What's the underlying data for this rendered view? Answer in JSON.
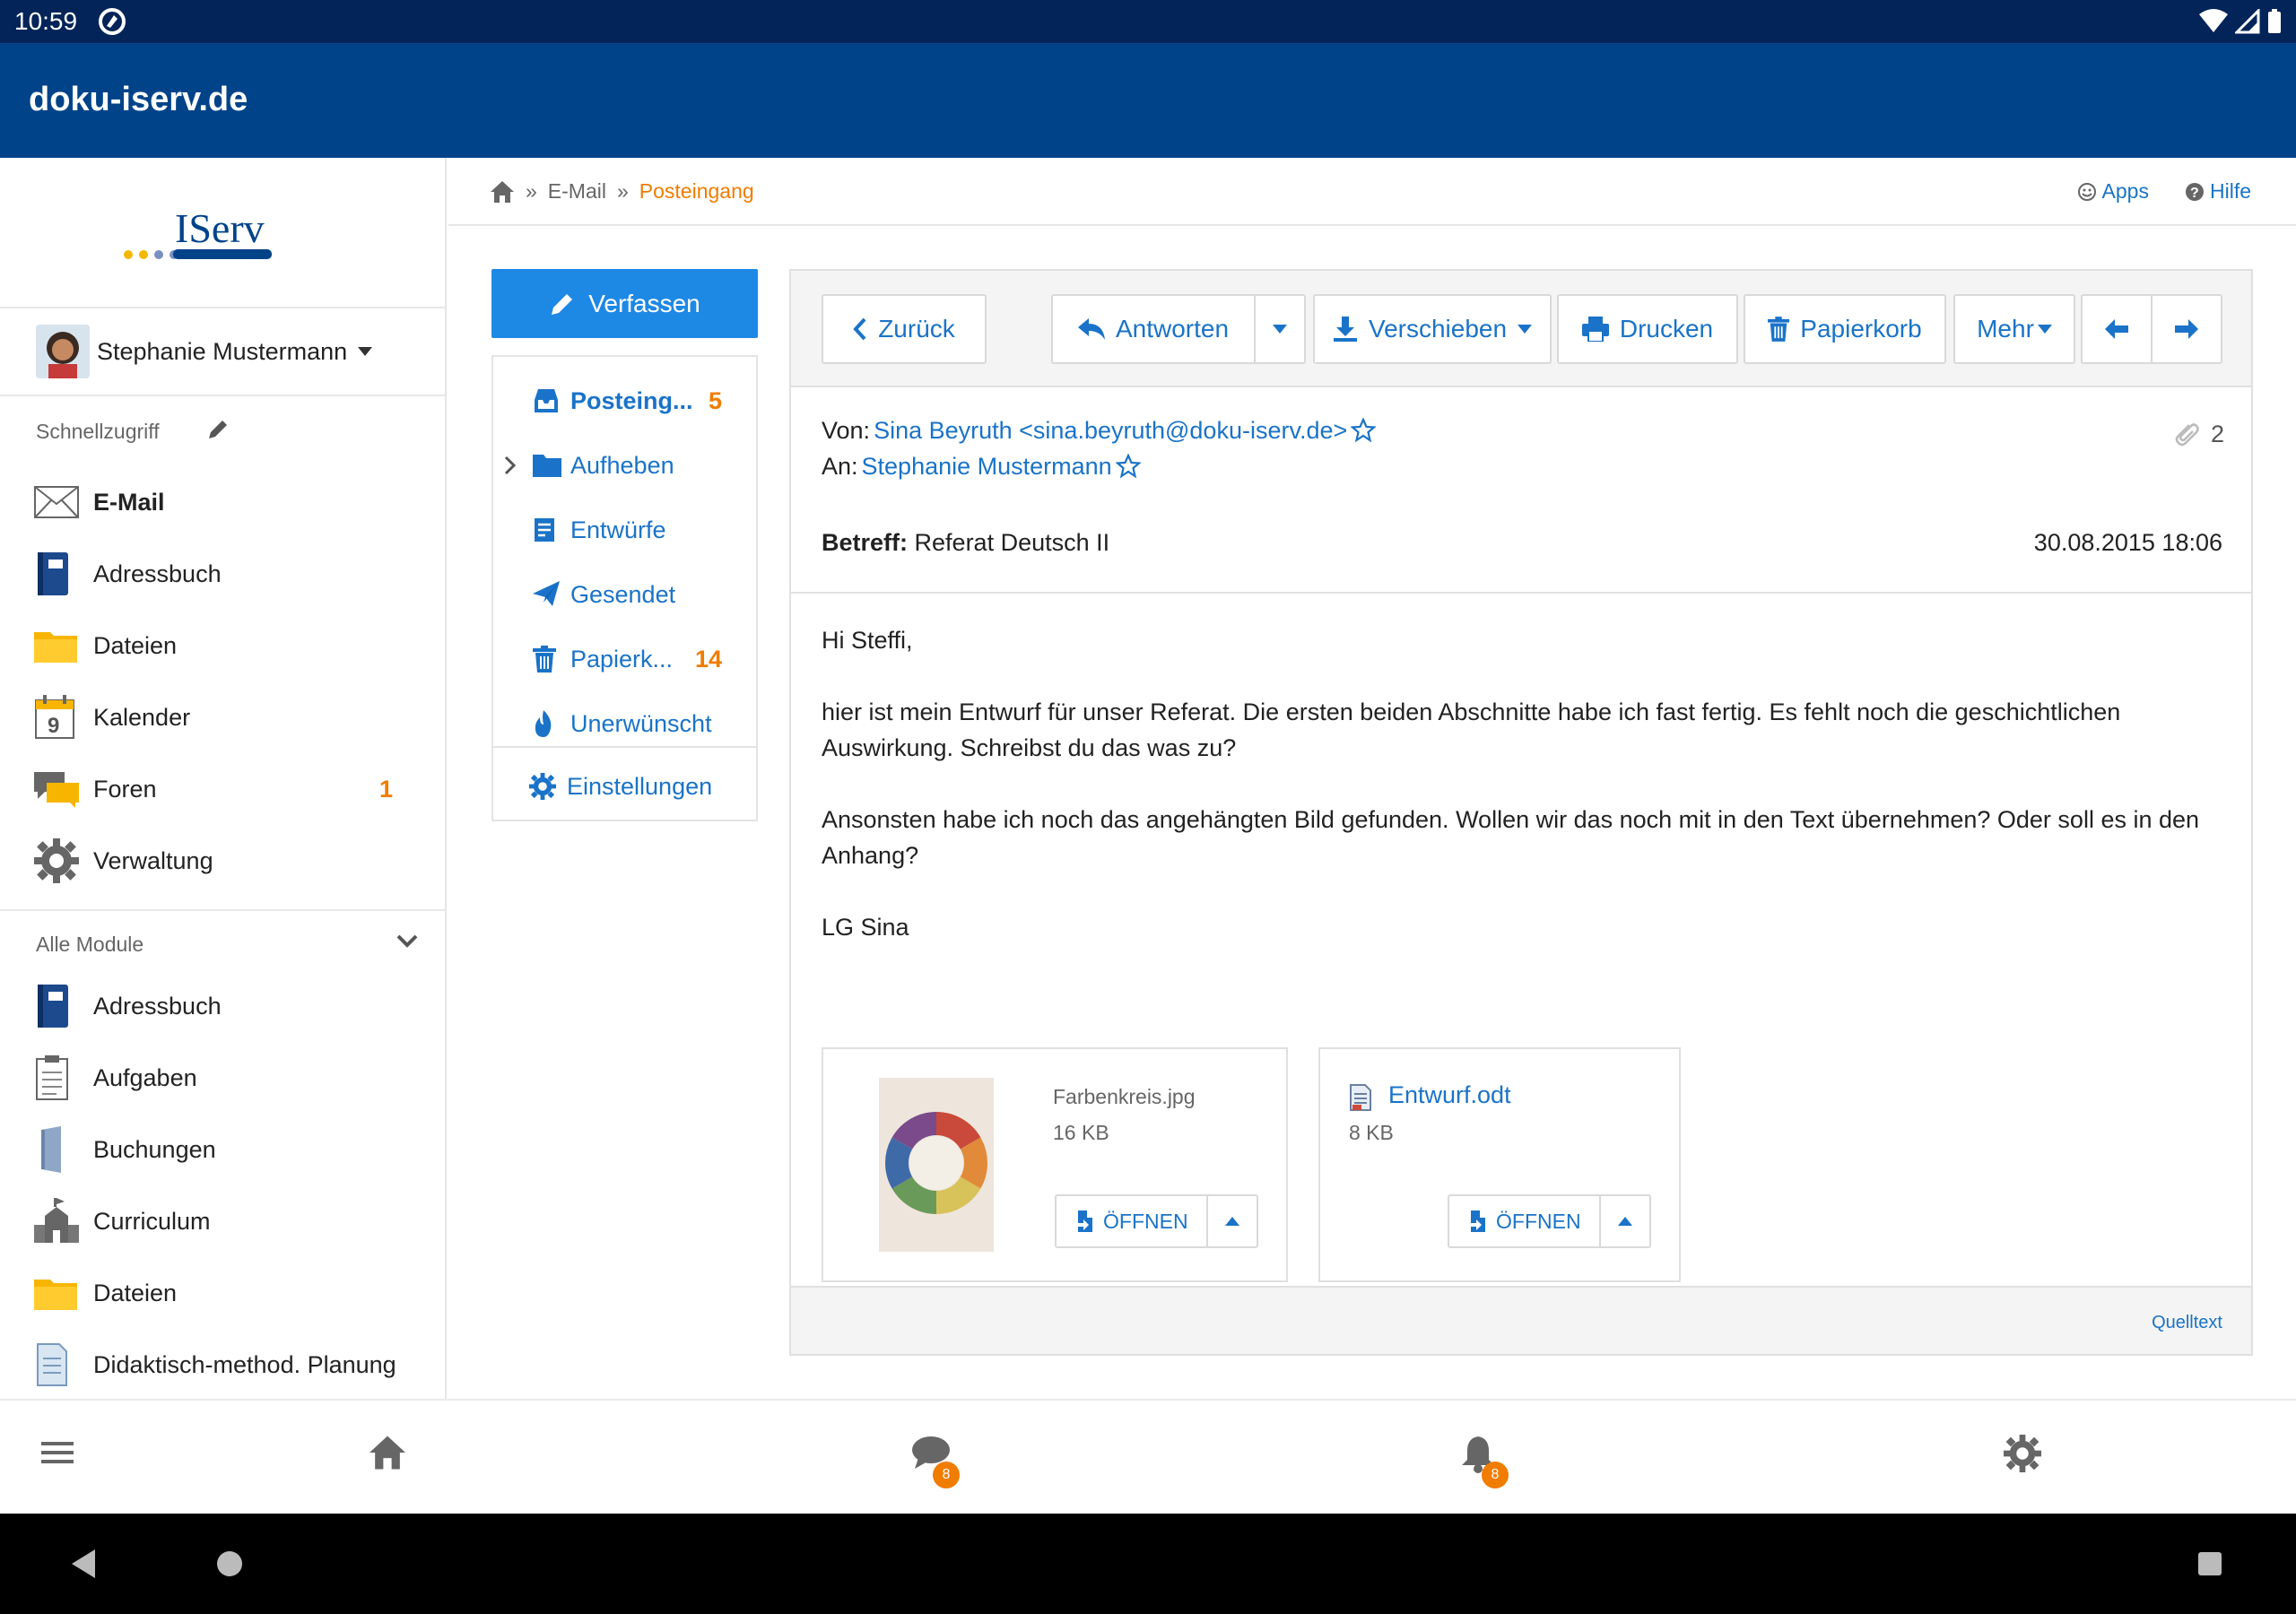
{
  "status_bar": {
    "time": "10:59"
  },
  "app_bar": {
    "title": "doku-iserv.de"
  },
  "sidebar": {
    "logo_text": "IServ",
    "user_name": "Stephanie Mustermann",
    "quick_access_label": "Schnellzugriff",
    "quick_items": [
      {
        "label": "E-Mail",
        "icon": "envelope-icon",
        "badge": ""
      },
      {
        "label": "Adressbuch",
        "icon": "addressbook-icon",
        "badge": ""
      },
      {
        "label": "Dateien",
        "icon": "folder-icon",
        "badge": ""
      },
      {
        "label": "Kalender",
        "icon": "calendar-icon",
        "badge": ""
      },
      {
        "label": "Foren",
        "icon": "forum-icon",
        "badge": "1"
      },
      {
        "label": "Verwaltung",
        "icon": "gear-icon",
        "badge": ""
      }
    ],
    "modules_label": "Alle Module",
    "module_items": [
      {
        "label": "Adressbuch",
        "icon": "addressbook-icon"
      },
      {
        "label": "Aufgaben",
        "icon": "clipboard-icon"
      },
      {
        "label": "Buchungen",
        "icon": "door-icon"
      },
      {
        "label": "Curriculum",
        "icon": "school-icon"
      },
      {
        "label": "Dateien",
        "icon": "folder-icon"
      },
      {
        "label": "Didaktisch-method. Planung",
        "icon": "document-icon"
      }
    ]
  },
  "breadcrumb": {
    "items": [
      "E-Mail",
      "Posteingang"
    ],
    "separator": "»"
  },
  "top_links": {
    "apps": "Apps",
    "help": "Hilfe"
  },
  "compose": {
    "label": "Verfassen"
  },
  "folders": [
    {
      "label": "Posteing...",
      "count": "5",
      "icon": "inbox-icon"
    },
    {
      "label": "Aufheben",
      "count": "",
      "icon": "folder-icon"
    },
    {
      "label": "Entwürfe",
      "count": "",
      "icon": "draft-icon"
    },
    {
      "label": "Gesendet",
      "count": "",
      "icon": "paper-plane-icon"
    },
    {
      "label": "Papierk...",
      "count": "14",
      "icon": "trash-icon"
    },
    {
      "label": "Unerwünscht",
      "count": "",
      "icon": "fire-icon"
    }
  ],
  "folder_settings": {
    "label": "Einstellungen"
  },
  "toolbar": {
    "back": "Zurück",
    "reply": "Antworten",
    "move": "Verschieben",
    "print": "Drucken",
    "trash": "Papierkorb",
    "more": "Mehr"
  },
  "mail": {
    "from_label": "Von:",
    "from_value": "Sina Beyruth <sina.beyruth@doku-iserv.de>",
    "to_label": "An:",
    "to_value": "Stephanie Mustermann",
    "attachment_count": "2",
    "subject_label": "Betreff:",
    "subject": "Referat Deutsch II",
    "date": "30.08.2015 18:06",
    "body": [
      "Hi Steffi,",
      "hier ist mein Entwurf für unser Referat. Die ersten beiden Abschnitte habe ich fast fertig. Es fehlt noch die geschichtlichen Auswirkung. Schreibst du das was zu?",
      "Ansonsten habe ich noch das angehängten Bild gefunden. Wollen wir das noch mit in den Text übernehmen? Oder soll es in den Anhang?",
      "LG Sina"
    ],
    "attachments": [
      {
        "name": "Farbenkreis.jpg",
        "size": "16 KB",
        "open_label": "ÖFFNEN"
      },
      {
        "name": "Entwurf.odt",
        "size": "8 KB",
        "open_label": "ÖFFNEN"
      }
    ],
    "source_link": "Quelltext"
  },
  "bottom_bar": {
    "chat_badge": "8",
    "notification_badge": "8"
  },
  "colors": {
    "status_bar": "#022458",
    "app_bar": "#004389",
    "accent": "#1a73c8",
    "compose": "#1e88e5",
    "badge": "#f07c00"
  }
}
